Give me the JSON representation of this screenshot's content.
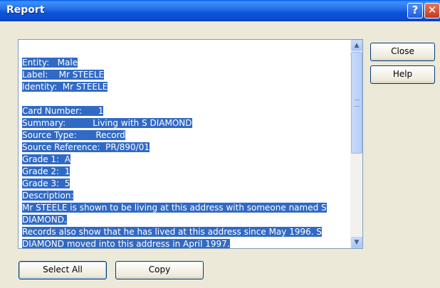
{
  "window": {
    "title": "Report"
  },
  "titlebar": {
    "help_label": "?",
    "close_label": "✕"
  },
  "buttons": {
    "close": "Close",
    "help": "Help",
    "select_all": "Select All",
    "copy": "Copy"
  },
  "report": {
    "lines": [
      "Entity:   Male",
      "Label:    Mr STEELE",
      "Identity:  Mr STEELE",
      "",
      "Card Number:      1",
      "Summary:          Living with S DIAMOND",
      "Source Type:       Record",
      "Source Reference:  PR/890/01",
      "Grade 1:  A",
      "Grade 2:  1",
      "Grade 3:  5",
      "Description:",
      "Mr STEELE is shown to be living at this address with someone named S",
      "DIAMOND.",
      "Records also show that he has lived at this address since May 1996. S",
      "DIAMOND moved into this address in April 1997."
    ]
  },
  "icons": {
    "scroll_up": "up-arrow",
    "scroll_down": "down-arrow"
  }
}
